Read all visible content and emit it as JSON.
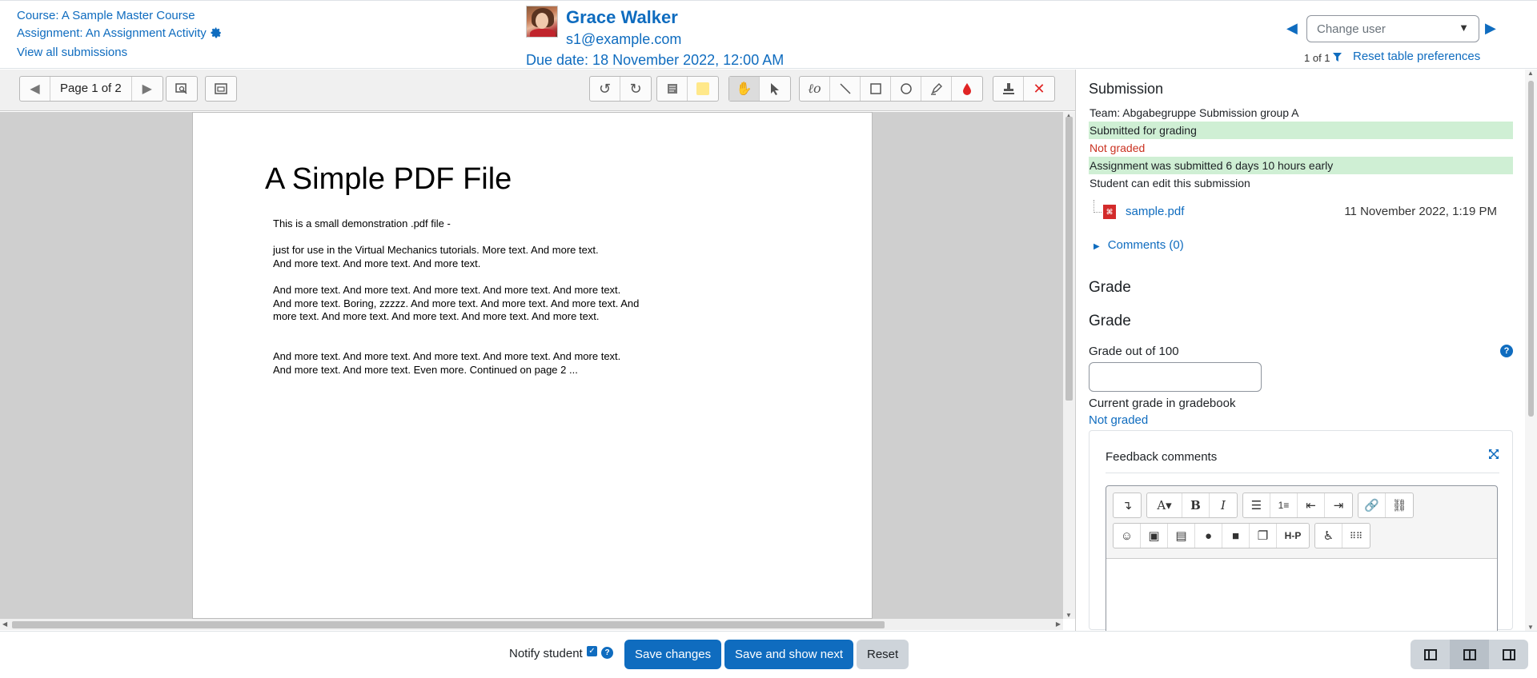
{
  "header": {
    "course_link": "Course: A Sample Master Course",
    "assignment_link": "Assignment: An Assignment Activity",
    "view_all_link": "View all submissions",
    "user_name": "Grace Walker",
    "user_email": "s1@example.com",
    "due_date": "Due date: 18 November 2022, 12:00 AM",
    "change_user_placeholder": "Change user",
    "user_count": "1 of 1",
    "reset_prefs": "Reset table preferences"
  },
  "toolbar": {
    "page_label": "Page 1 of 2"
  },
  "pdf": {
    "title": "A Simple PDF File",
    "paragraphs": [
      "This is a small demonstration .pdf file -",
      "just for use in the Virtual Mechanics tutorials. More text. And more text. And more text. And more text. And more text.",
      "And more text. And more text. And more text. And more text. And more text. And more text. Boring, zzzzz. And more text. And more text. And more text. And more text. And more text. And more text. And more text. And more text.",
      "And more text. And more text. And more text. And more text. And more text. And more text. And more text. Even more. Continued on page 2 ..."
    ]
  },
  "submission": {
    "title": "Submission",
    "team": "Team: Abgabegruppe Submission group A",
    "status": "Submitted for grading",
    "grading_status": "Not graded",
    "timing": "Assignment was submitted 6 days 10 hours early",
    "edit_status": "Student can edit this submission",
    "file_name": "sample.pdf",
    "file_date": "11 November 2022, 1:19 PM",
    "comments": "Comments (0)"
  },
  "grade": {
    "section_title": "Grade",
    "sub_title": "Grade",
    "grade_label": "Grade out of 100",
    "grade_value": "",
    "current_label": "Current grade in gradebook",
    "current_value": "Not graded",
    "feedback_title": "Feedback comments"
  },
  "footer": {
    "notify_label": "Notify student",
    "save_changes": "Save changes",
    "save_next": "Save and show next",
    "reset": "Reset"
  },
  "colors": {
    "accent": "#0f6cbf",
    "success_bg": "#cfefd4",
    "danger": "#ca3120"
  }
}
